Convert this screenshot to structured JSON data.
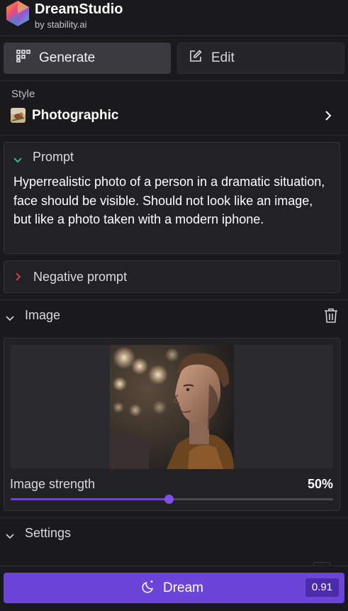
{
  "header": {
    "app_name": "DreamStudio",
    "byline": "by stability.ai"
  },
  "tabs": [
    {
      "label": "Generate",
      "icon": "grid-icon",
      "active": true
    },
    {
      "label": "Edit",
      "icon": "edit-icon",
      "active": false
    }
  ],
  "style": {
    "label": "Style",
    "value": "Photographic"
  },
  "prompt": {
    "title": "Prompt",
    "expanded": true,
    "text": "Hyperrealistic photo of a person in a dramatic situation, face should be visible. Should not look like an image, but like a photo taken with a modern iphone."
  },
  "negative_prompt": {
    "title": "Negative prompt",
    "expanded": false
  },
  "image": {
    "title": "Image",
    "strength_label": "Image strength",
    "strength_value": "50%",
    "strength_fraction": 0.5
  },
  "settings": {
    "title": "Settings"
  },
  "dream": {
    "label": "Dream",
    "cost": "0.91"
  },
  "colors": {
    "accent": "#6a45d8",
    "background": "#1a1a1d",
    "panel": "#222226",
    "prompt_chevron": "#3cc08a",
    "negative_chevron": "#e0443c"
  }
}
